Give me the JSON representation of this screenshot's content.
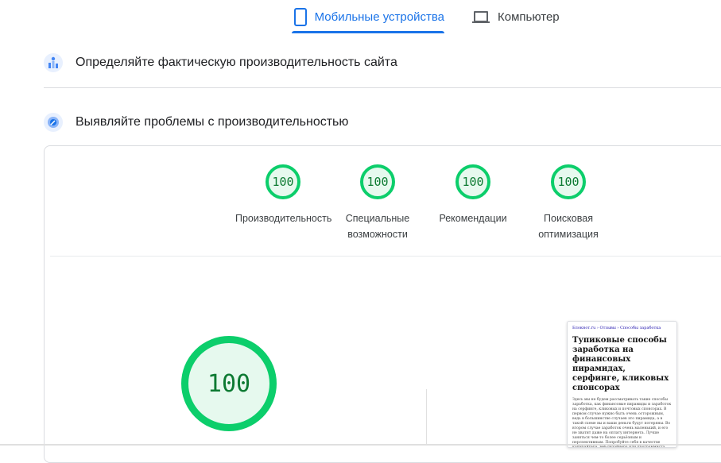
{
  "tabs": {
    "mobile": {
      "label": "Мобильные устройства",
      "icon": "smartphone-icon",
      "active": true
    },
    "desktop": {
      "label": "Компьютер",
      "icon": "laptop-icon",
      "active": false
    }
  },
  "sections": {
    "field_data": {
      "title": "Определяйте фактическую производительность сайта",
      "icon": "users-chart-icon"
    },
    "lab_data": {
      "title": "Выявляйте проблемы с производительностью",
      "icon": "compass-icon"
    }
  },
  "scores": [
    {
      "value": "100",
      "label": "Производительность"
    },
    {
      "value": "100",
      "label": "Специальные возможности"
    },
    {
      "value": "100",
      "label": "Рекомендации"
    },
    {
      "value": "100",
      "label": "Поисковая оптимизация"
    }
  ],
  "main_score": {
    "value": "100"
  },
  "preview": {
    "breadcrumb": "Блокнот.ru › Отзывы › Способы заработка",
    "title": "Тупиковые способы заработка на финансовых пирамидах, серфинге, кликовых спонсорах",
    "body": "Здесь мы не будем рассматривать такие способы заработка, как финансовые пирамиды и заработок на серфинге, кликовых и почтовых спонсорах. В первом случае нужно быть очень осторожным, ведь в большинстве случаев это пирамида, а в такой схеме вы и ваши деньги будут потеряны. Во втором случае заработок очень маленький, и его не хватит даже на оплату интернета. Лучше заняться чем-то более серьёзным и перспективным. Попробуйте себя в качестве копирайтера, веб-дизайнера или программиста."
  },
  "colors": {
    "accent": "#1a73e8",
    "pass": "#0cce6b",
    "pass_text": "#0d7a32",
    "pass_bg": "#e6f9ee"
  }
}
